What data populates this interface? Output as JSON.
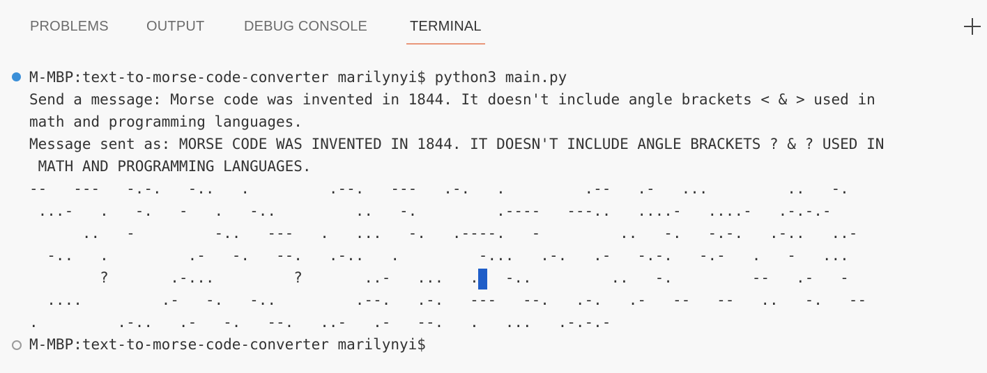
{
  "tabs": {
    "problems": "PROBLEMS",
    "output": "OUTPUT",
    "debug_console": "DEBUG CONSOLE",
    "terminal": "TERMINAL",
    "active": "TERMINAL",
    "active_underline_color": "#e9967a"
  },
  "toolbar": {
    "add_icon": "plus-icon"
  },
  "terminal": {
    "prompt_1": "M-MBP:text-to-morse-code-converter marilynyi$ python3 main.py",
    "out_1": "Send a message: Morse code was invented in 1844. It doesn't include angle brackets < & > used in",
    "out_2": "math and programming languages.",
    "out_3": "Message sent as: MORSE CODE WAS INVENTED IN 1844. IT DOESN'T INCLUDE ANGLE BRACKETS ? & ? USED IN",
    "out_4": " MATH AND PROGRAMMING LANGUAGES.",
    "morse_1": "--   ---   -.-.   -..   .         .--.   ---   .-.   .         .--   .-   ...         ..   -.",
    "morse_2": " ...-   .   -.   -   .   -..         ..   -.         .----   ---..   ....-   ....-   .-.-.-",
    "morse_3": "      ..   -         -..   ---   .   ...   -.   .----.   -         ..   -.   -.-.   .-..   ..-",
    "morse_4": "  -..   .         .-   -.   --.   .-..   .         -...   .-.   .-   -.-.   -.-   .   -   ...",
    "morse_5": "        ?       .-...         ?       ..-   ...   .   -..         ..   -.         --   .-   -",
    "morse_6": "  ....         .-   -.   -..         .--.   .-.   ---   --.   .-.   .-   --   --   ..   -.   --",
    "morse_7": ".         .-..   .-   -.   --.   ..-   .-   --.   .   ...   .-.-.-",
    "prompt_2": "M-MBP:text-to-morse-code-converter marilynyi$ ",
    "status_dot_color": "#3b8fd8",
    "cursor_color": "#1f5ec8"
  }
}
